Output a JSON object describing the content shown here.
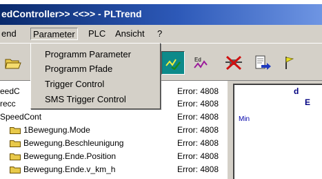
{
  "window": {
    "title": "edController>> <<>> - PLTrend"
  },
  "menubar": {
    "items": [
      {
        "label": "end"
      },
      {
        "label": "Parameter"
      },
      {
        "label": "PLC"
      },
      {
        "label": "Ansicht"
      },
      {
        "label": "?"
      }
    ]
  },
  "parameter_menu": {
    "items": [
      {
        "label": "Programm Parameter"
      },
      {
        "label": "Programm Pfade"
      },
      {
        "label": "Trigger Control"
      },
      {
        "label": "SMS Trigger Control"
      }
    ]
  },
  "toolbar": {
    "buttons": [
      {
        "icon": "open-folder-icon"
      },
      {
        "icon": "trend-check-icon"
      },
      {
        "icon": "trend-edit-icon"
      },
      {
        "icon": "disconnect-plug-icon"
      },
      {
        "icon": "export-arrow-icon"
      },
      {
        "icon": "flag-icon"
      }
    ]
  },
  "tree": {
    "rows": [
      {
        "name": "eedC",
        "value": "Error: 4808",
        "folder": false
      },
      {
        "name": "recc",
        "value": "Error: 4808",
        "folder": false
      },
      {
        "name": "SpeedCont",
        "value": "Error: 4808",
        "folder": false
      },
      {
        "name": "1Bewegung.Mode",
        "value": "Error: 4808",
        "folder": true
      },
      {
        "name": "Bewegung.Beschleunigung",
        "value": "Error: 4808",
        "folder": true
      },
      {
        "name": "Bewegung.Ende.Position",
        "value": "Error: 4808",
        "folder": true
      },
      {
        "name": "Bewegung.Ende.v_km_h",
        "value": "Error: 4808",
        "folder": true
      }
    ]
  },
  "chart": {
    "min_label": "Min",
    "title_line1": "d",
    "title_line2": "E"
  },
  "colors": {
    "titlebar_start": "#0a2a6c",
    "titlebar_end": "#6e95e3",
    "face": "#d4d0c8",
    "folder": "#e8c94a",
    "pressed_button": "#0d8a8a"
  }
}
